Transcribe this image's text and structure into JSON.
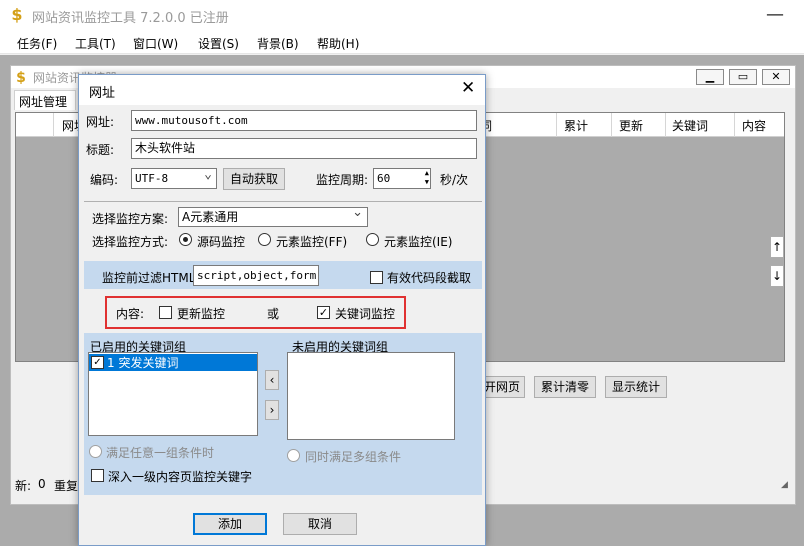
{
  "app": {
    "title": "网站资讯监控工具 7.2.0.0  已注册"
  },
  "menu": [
    "任务(F)",
    "工具(T)",
    "窗口(W)",
    "设置(S)",
    "背景(B)",
    "帮助(H)"
  ],
  "child": {
    "title": "网站资讯监控器",
    "tab": "网址管理",
    "columns": [
      "网址",
      "词",
      "累计",
      "更新",
      "关键词",
      "内容"
    ],
    "buttons": {
      "open_page": "开网页",
      "clear_count": "累计清零",
      "show_stats": "显示统计"
    },
    "status": {
      "new_label": "新:",
      "new_value": "0",
      "repeat_label": "重复"
    }
  },
  "dialog": {
    "title": "网址",
    "url_label": "网址:",
    "url_value": "www.mutousoft.com",
    "title_label": "标题:",
    "title_value": "木头软件站",
    "encoding_label": "编码:",
    "encoding_value": "UTF-8",
    "auto_get": "自动获取",
    "period_label": "监控周期:",
    "period_value": "60",
    "period_unit": "秒/次",
    "scheme_label": "选择监控方案:",
    "scheme_value": "A元素通用",
    "mode_label": "选择监控方式:",
    "mode_options": [
      "源码监控",
      "元素监控(FF)",
      "元素监控(IE)"
    ],
    "filter_label": "监控前过滤HTML",
    "filter_value": "script,object,form",
    "valid_code_label": "有效代码段截取",
    "content_label": "内容:",
    "update_monitor": "更新监控",
    "or_label": "或",
    "keyword_monitor": "关键词监控",
    "enabled_groups_label": "已启用的关键词组",
    "enabled_groups": [
      "1 突发关键词"
    ],
    "disabled_groups_label": "未启用的关键词组",
    "any_group": "满足任意一组条件时",
    "all_groups": "同时满足多组条件",
    "deep_monitor": "深入一级内容页监控关键字",
    "add_button": "添加",
    "cancel_button": "取消"
  },
  "colors": {
    "highlight_border": "#e03131",
    "selection": "#0078d7",
    "panel_blue": "#c5d9ee"
  }
}
